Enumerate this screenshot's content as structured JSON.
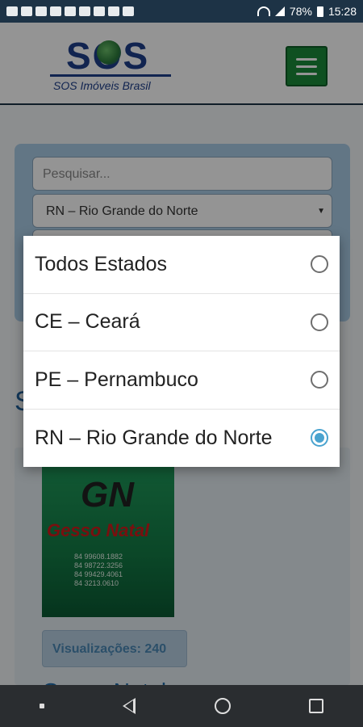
{
  "status_bar": {
    "battery": "78%",
    "time": "15:28",
    "left_icons": [
      "facebook-icon",
      "mail-icon",
      "doc-icon",
      "youtube-icon",
      "youtube-icon",
      "youtube-icon",
      "youtube-icon",
      "youtube-icon",
      "image-icon"
    ]
  },
  "header": {
    "logo_text": "SOS Imóveis Brasil",
    "logo_mark": "SOS",
    "menu_icon": "hamburger-icon",
    "menu_color": "#1b8a3a"
  },
  "search": {
    "placeholder": "Pesquisar...",
    "state_selected": "RN – Rio Grande do Norte"
  },
  "section": {
    "title_partial": "S"
  },
  "card": {
    "image_brand": "GN",
    "image_name": "Gesso Natal",
    "image_phones": [
      "84 99608.1882",
      "84 98722.3256",
      "84 99429.4061",
      "84 3213.0610"
    ],
    "views": "Visualizações: 240",
    "title": "Gesso Natal"
  },
  "dialog": {
    "options": [
      {
        "label": "Todos Estados",
        "checked": false
      },
      {
        "label": "CE – Ceará",
        "checked": false
      },
      {
        "label": "PE – Pernambuco",
        "checked": false
      },
      {
        "label": "RN – Rio Grande do Norte",
        "checked": true
      }
    ],
    "accent_color": "#4aa3cf"
  },
  "nav_bar": {
    "buttons": [
      "back-icon",
      "home-icon",
      "recent-apps-icon"
    ]
  }
}
